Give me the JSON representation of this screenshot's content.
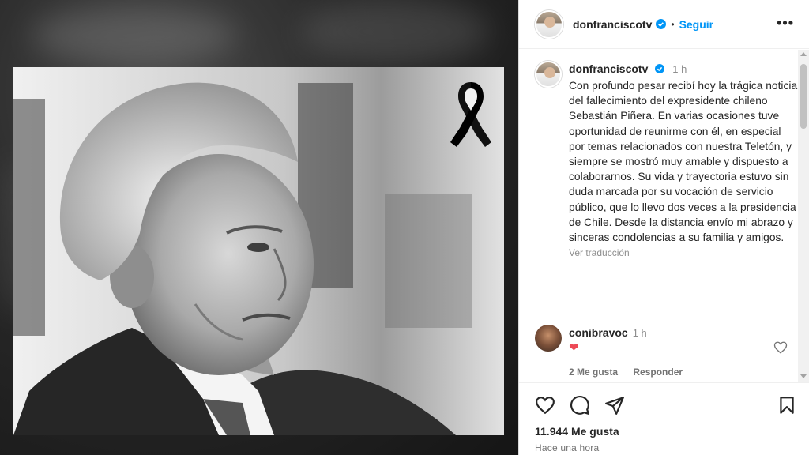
{
  "post": {
    "username": "donfranciscotv",
    "follow_label": "Seguir",
    "separator": "•",
    "more_label": "•••",
    "caption_time": "1 h",
    "caption_text": "Con profundo pesar recibí hoy la trágica noticia del fallecimiento del expresidente chileno Sebastián Piñera. En varias ocasiones tuve oportunidad de reunirme con él, en especial por temas relacionados con nuestra Teletón, y siempre se mostró muy amable y dispuesto a colaborarnos. Su vida y trayectoria estuvo sin duda marcada por su vocación de servicio público, que lo llevo dos veces a la presidencia de Chile. Desde la distancia envío mi abrazo y sinceras condolencias a su familia y amigos.",
    "translate_label": "Ver traducción",
    "likes": "11.944 Me gusta",
    "time_ago": "Hace una hora"
  },
  "comment": {
    "username": "conibravoc",
    "time": "1 h",
    "heart": "❤",
    "likes_label": "2 Me gusta",
    "reply_label": "Responder"
  },
  "colors": {
    "accent": "#0095f6",
    "heart": "#ed4956",
    "muted": "#737373"
  }
}
